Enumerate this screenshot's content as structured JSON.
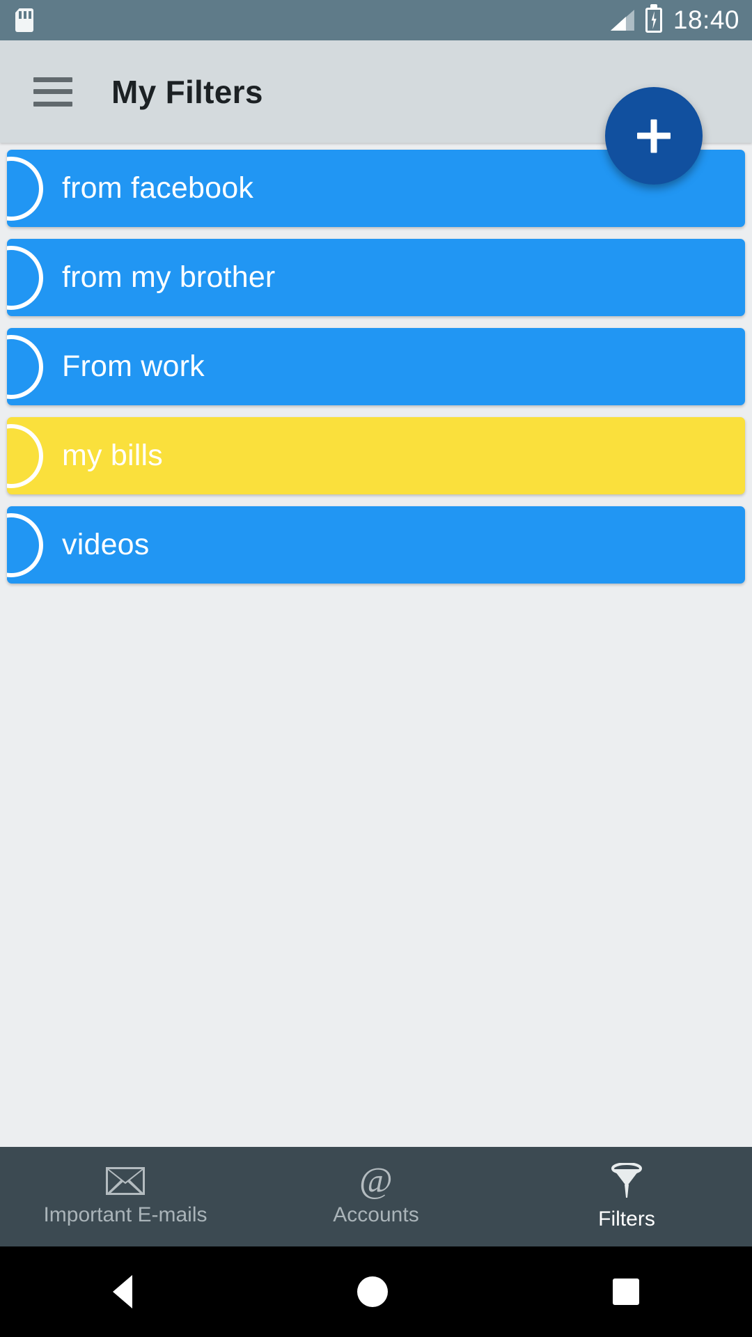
{
  "status_bar": {
    "background": "#5f7b89",
    "sd_icon": "sd-card-icon",
    "signal_icon": "signal-bars-icon",
    "battery_icon": "battery-charging-icon",
    "time": "18:40"
  },
  "app_bar": {
    "background": "#d4dadd",
    "menu_icon": "hamburger-menu-icon",
    "title": "My Filters"
  },
  "fab": {
    "icon": "plus-icon",
    "label": "+",
    "color": "#11509f"
  },
  "filters": {
    "items": [
      {
        "label": "from facebook",
        "color": "#2196f3"
      },
      {
        "label": "from my brother",
        "color": "#2196f3"
      },
      {
        "label": "From work",
        "color": "#2196f3"
      },
      {
        "label": "my bills",
        "color": "#fae03c"
      },
      {
        "label": "videos",
        "color": "#2196f3"
      }
    ]
  },
  "bottom_nav": {
    "background": "#3c4a52",
    "items": [
      {
        "label": "Important E-mails",
        "icon": "envelope-icon",
        "active": false
      },
      {
        "label": "Accounts",
        "icon": "at-sign-icon",
        "active": false
      },
      {
        "label": "Filters",
        "icon": "funnel-icon",
        "active": true
      }
    ]
  },
  "system_nav": {
    "back": "back-triangle-icon",
    "home": "home-circle-icon",
    "recents": "recents-square-icon"
  }
}
